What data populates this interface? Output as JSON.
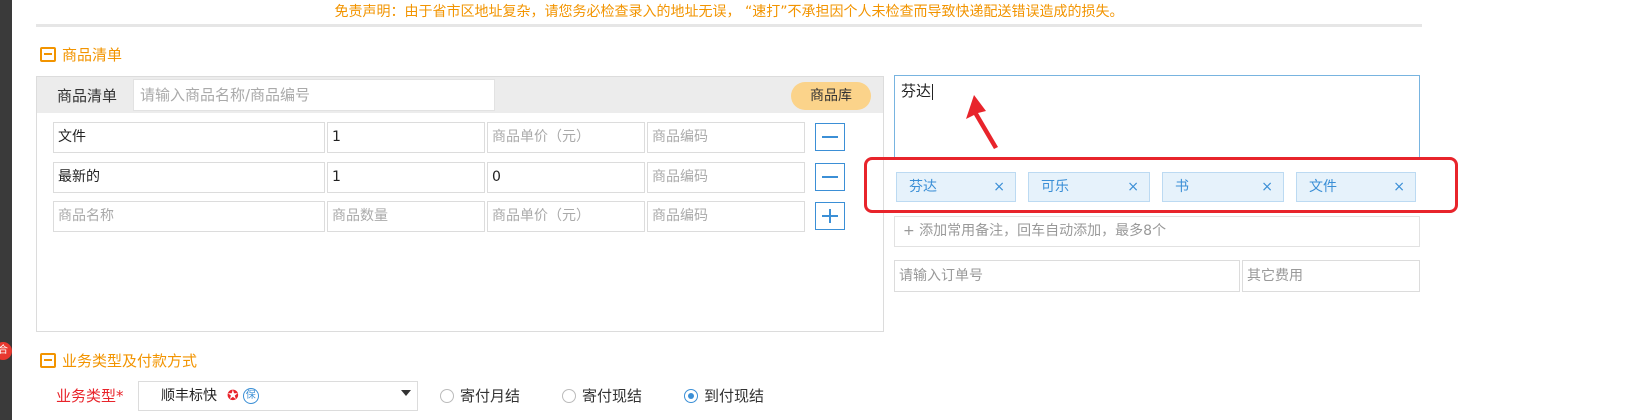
{
  "disclaimer": "免责声明：由于省市区地址复杂，请您务必检查录入的地址无误， “速打”不承担因个人未检查而导致快递配送错误造成的损失。",
  "side_badge": "合",
  "goods_section": {
    "title": "商品清单",
    "header_label": "商品清单",
    "search_placeholder": "请输入商品名称/商品编号",
    "library_button": "商品库",
    "rows": [
      {
        "name": "文件",
        "qty": "1",
        "price": "商品单价（元）",
        "code": "商品编码",
        "action": "remove"
      },
      {
        "name": "最新的",
        "qty": "1",
        "price": "0",
        "code": "商品编码",
        "action": "remove"
      },
      {
        "name": "商品名称",
        "qty": "商品数量",
        "price": "商品单价（元）",
        "code": "商品编码",
        "action": "add"
      }
    ]
  },
  "remark": {
    "value": "芬达",
    "tags": [
      {
        "label": "芬达",
        "close": "×"
      },
      {
        "label": "可乐",
        "close": "×"
      },
      {
        "label": "书",
        "close": "×"
      },
      {
        "label": "文件",
        "close": "×"
      }
    ],
    "add_hint": "+ 添加常用备注，回车自动添加，最多8个",
    "order_no_placeholder": "请输入订单号",
    "other_fee_placeholder": "其它费用"
  },
  "business_section": {
    "title": "业务类型及付款方式",
    "type_label": "业务类型*",
    "type_value": "顺丰标快",
    "insured_icon": "保",
    "payment_options": [
      {
        "label": "寄付月结",
        "selected": false
      },
      {
        "label": "寄付现结",
        "selected": false
      },
      {
        "label": "到付现结",
        "selected": true
      }
    ]
  },
  "colors": {
    "accent_orange": "#f29400",
    "highlight_red": "#e8242b",
    "link_blue": "#3b8fd6"
  }
}
